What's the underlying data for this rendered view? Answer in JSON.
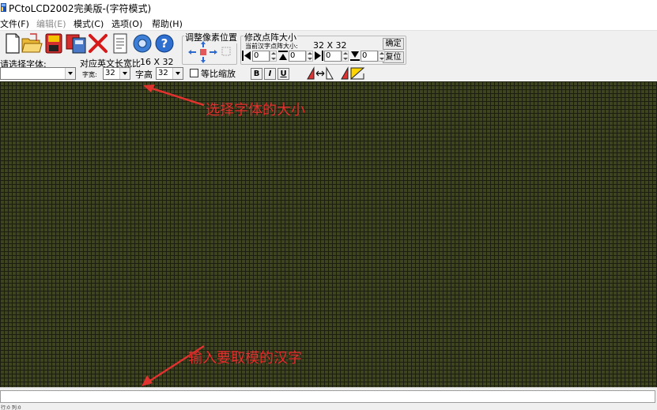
{
  "window": {
    "title": "PCtoLCD2002完美版-(字符模式)"
  },
  "menu": [
    {
      "label": "文件(F)",
      "enabled": true
    },
    {
      "label": "编辑(E)",
      "enabled": false
    },
    {
      "label": "模式(C)",
      "enabled": true
    },
    {
      "label": "选项(O)",
      "enabled": true
    },
    {
      "label": "帮助(H)",
      "enabled": true
    }
  ],
  "toolbar": {
    "icons": [
      "new-file-icon",
      "open-folder-icon",
      "save-icon",
      "save-as-icon",
      "delete-icon",
      "document-icon",
      "settings-gear-icon",
      "help-icon"
    ],
    "font_label": "请选择字体:",
    "font_value": "",
    "english_width_label": "对应英文长宽比",
    "english_width_value": "16 X 32",
    "char_width_label": "字宽:",
    "char_width_value": "32",
    "char_height_label": "字高",
    "char_height_value": "32",
    "proportional_label": "等比缩放",
    "proportional_checked": false,
    "format_buttons": [
      "B",
      "I",
      "U"
    ]
  },
  "pixel_group": {
    "title": "调整像素位置"
  },
  "matrix_group": {
    "title": "修改点阵大小",
    "current_label": "当前汉字点阵大小:",
    "current_value": "32 X 32",
    "confirm_button": "确定",
    "reset_button": "复位",
    "spinners": [
      "0",
      "0",
      "0",
      "0"
    ]
  },
  "canvas": {
    "grid_color": "#3e4420",
    "line_color": "#1b1d10"
  },
  "annotations": {
    "font_size_note": "选择字体的大小",
    "input_note": "输入要取模的汉字",
    "color": "#e0322e"
  },
  "input": {
    "value": "",
    "placeholder": ""
  },
  "status": {
    "left_text": "行:0 列:0"
  }
}
